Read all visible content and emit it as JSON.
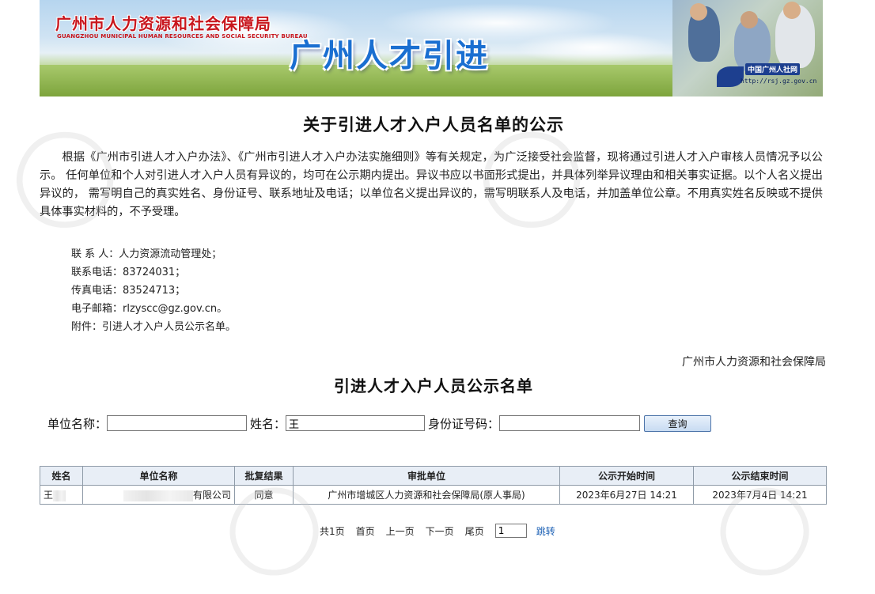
{
  "header": {
    "bureau_cn": "广州市人力资源和社会保障局",
    "bureau_en": "GUANGZHOU MUNICIPAL HUMAN RESOURCES AND SOCIAL SECURITY BUREAU",
    "slogan": "广州人才引进",
    "logo_name": "中国广州人社网",
    "logo_url": "http://rsj.gz.gov.cn"
  },
  "notice": {
    "title": "关于引进人才入户人员名单的公示",
    "body": "根据《广州市引进人才入户办法》、《广州市引进人才入户办法实施细则》等有关规定，为广泛接受社会监督，现将通过引进人才入户审核人员情况予以公示。 任何单位和个人对引进人才入户人员有异议的，均可在公示期内提出。异议书应以书面形式提出，并具体列举异议理由和相关事实证据。以个人名义提出异议的， 需写明自己的真实姓名、身份证号、联系地址及电话；以单位名义提出异议的，需写明联系人及电话，并加盖单位公章。不用真实姓名反映或不提供具体事实材料的，不予受理。",
    "contacts": [
      "联 系 人：人力资源流动管理处；",
      "联系电话：83724031；",
      "传真电话：83524713；",
      "电子邮箱：rlzyscc@gz.gov.cn。",
      "附件：引进人才入户人员公示名单。"
    ],
    "signature": "广州市人力资源和社会保障局"
  },
  "list": {
    "title": "引进人才入户人员公示名单"
  },
  "search": {
    "unit_label": "单位名称：",
    "unit_value": "",
    "name_label": "姓名：",
    "name_value": "王",
    "id_label": "身份证号码：",
    "id_value": "",
    "button_label": "查询"
  },
  "table": {
    "headers": [
      "姓名",
      "单位名称",
      "批复结果",
      "审批单位",
      "公示开始时间",
      "公示结束时间"
    ],
    "rows": [
      {
        "name": "王",
        "unit": "有限公司",
        "result": "同意",
        "approver": "广州市增城区人力资源和社会保障局(原人事局)",
        "start": "2023年6月27日 14:21",
        "end": "2023年7月4日 14:21"
      }
    ]
  },
  "pager": {
    "total": "共1页",
    "first": "首页",
    "prev": "上一页",
    "next": "下一页",
    "last": "尾页",
    "page_value": "1",
    "jump": "跳转"
  },
  "colors": {
    "bureau_red": "#c8161d",
    "slogan_blue": "#1a6fd1",
    "table_header_bg": "#e8eef6",
    "link_blue": "#1a5fb4"
  }
}
